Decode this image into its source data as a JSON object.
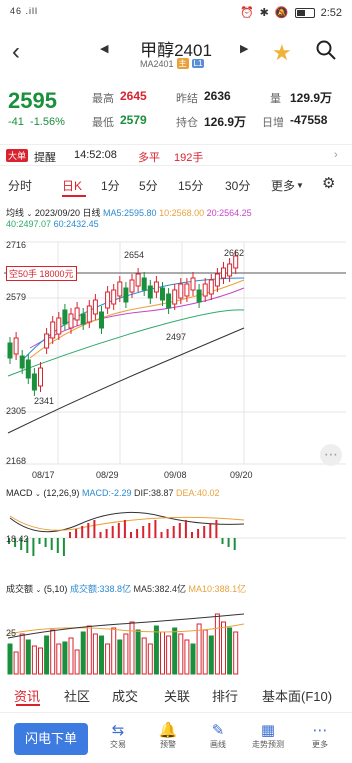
{
  "status": {
    "signal": "46 .ill",
    "time": "2:52",
    "icons": [
      "alarm-icon",
      "bluetooth-icon",
      "mute-icon"
    ]
  },
  "header": {
    "title": "甲醇2401",
    "code": "MA2401",
    "tag_main": "主",
    "tag_l1": "L1"
  },
  "quote": {
    "last": "2595",
    "change": "-41",
    "change_pct": "-1.56%",
    "high_label": "最高",
    "high": "2645",
    "low_label": "最低",
    "low": "2579",
    "prev_settle_label": "昨结",
    "prev_settle": "2636",
    "open_int_label": "持仓",
    "open_int": "126.9万",
    "volume_label": "量",
    "volume": "129.9万",
    "daily_inc_label": "日增",
    "daily_inc": "-47558"
  },
  "ticker": {
    "badge": "大单",
    "text": "提醒",
    "time": "14:52:08",
    "dir": "多平",
    "qty": "192手"
  },
  "tabs": [
    "分时",
    "日K",
    "1分",
    "5分",
    "15分",
    "30分",
    "更多"
  ],
  "active_tab": "日K",
  "ma": {
    "indicator": "均线",
    "date": "2023/09/20",
    "period": "日线",
    "ma5": "MA5:2595.80",
    "ma10": "10:2568.00",
    "ma20": "20:2564.25",
    "ma40": "40:2497.07",
    "ma60": "60:2432.45"
  },
  "chart": {
    "y_labels": [
      "2716",
      "2579",
      "2305",
      "2168"
    ],
    "x_labels": [
      "08/17",
      "08/29",
      "09/08",
      "09/20"
    ],
    "annotations": [
      "2654",
      "2662",
      "2497",
      "2341"
    ],
    "position_tag": "空50手  18000元"
  },
  "macd": {
    "label": "MACD",
    "params": "(12,26,9)",
    "macd": "MACD:-2.29",
    "dif": "DIF:38.87",
    "dea": "DEA:40.02",
    "y_label": "18.42"
  },
  "volume": {
    "label": "成交额",
    "params": "(5,10)",
    "amount": "成交额:338.8亿",
    "ma5": "MA5:382.4亿",
    "ma10": "MA10:388.1亿",
    "y_label": "25"
  },
  "bottom_tabs": [
    "资讯",
    "社区",
    "成交",
    "关联",
    "排行",
    "基本面(F10)"
  ],
  "active_bottom_tab": "资讯",
  "bottom_bar": {
    "flash_button": "闪电下单",
    "items": [
      {
        "label": "交易",
        "icon": "trade-icon"
      },
      {
        "label": "预警",
        "icon": "bell-icon"
      },
      {
        "label": "画线",
        "icon": "pen-icon"
      },
      {
        "label": "走势预测",
        "icon": "forecast-icon"
      },
      {
        "label": "更多",
        "icon": "more-icon"
      }
    ]
  },
  "colors": {
    "up": "#d8232f",
    "down": "#1a8f3c",
    "accent": "#3d7be0",
    "ma5": "#333333",
    "ma10": "#e9a23b",
    "ma20": "#c846c8",
    "ma40": "#2eaa6a",
    "ma60": "#2a8ad0"
  }
}
